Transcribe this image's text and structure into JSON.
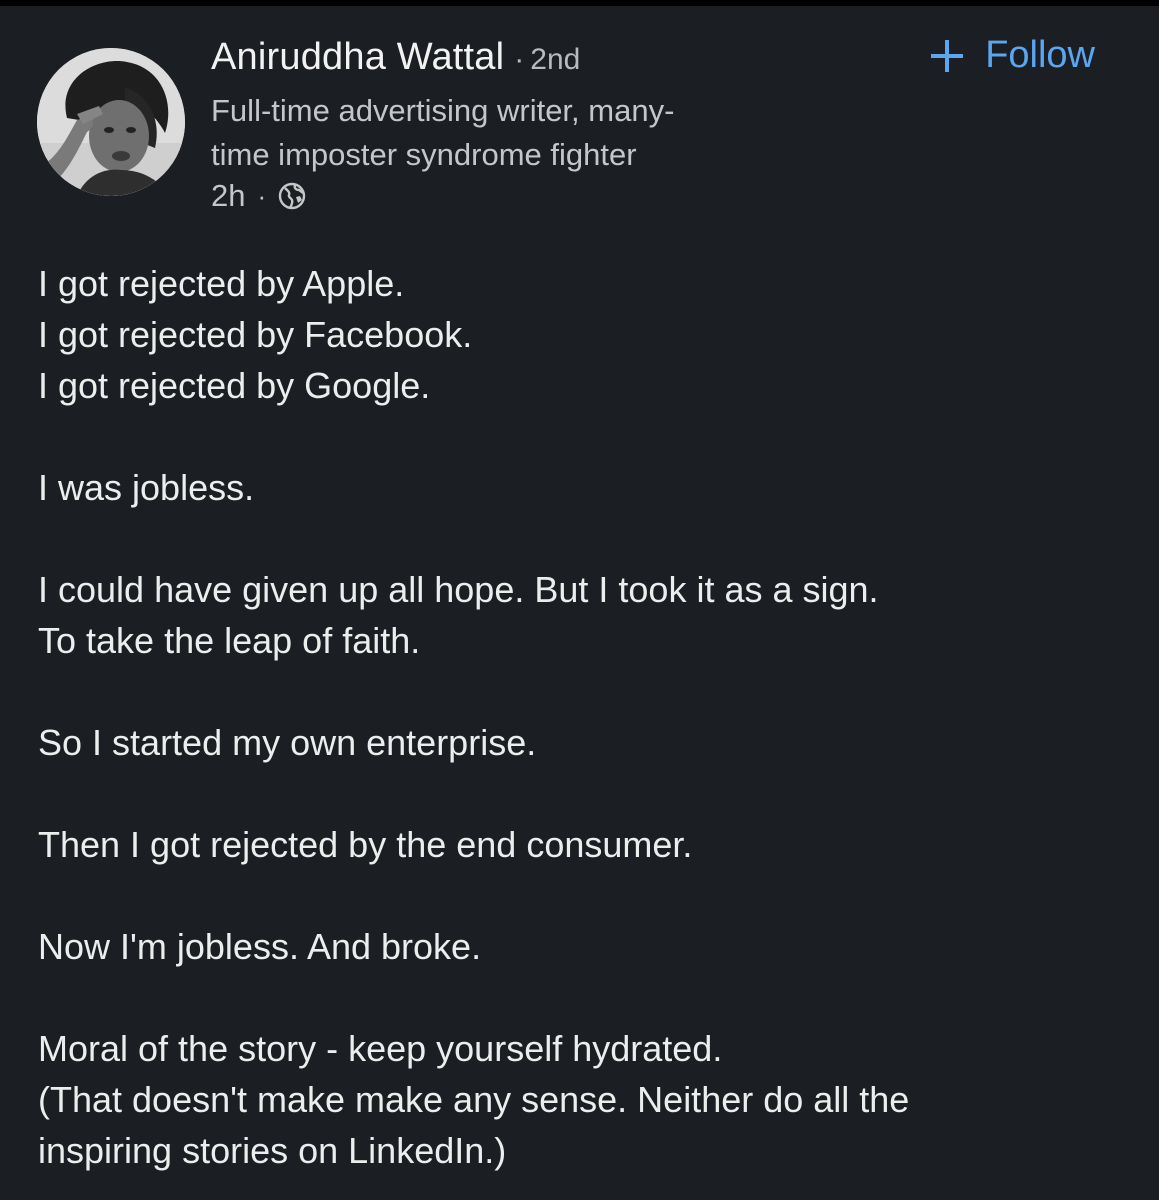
{
  "author": {
    "name": "Aniruddha Wattal",
    "degree_separator": "·",
    "degree": "2nd",
    "headline_lines": [
      "Full-time advertising writer, many-",
      "time imposter syndrome fighter"
    ],
    "time": "2h",
    "meta_separator": "·",
    "visibility_icon": "globe-icon"
  },
  "follow_button": {
    "icon": "plus-icon",
    "label": "Follow",
    "color": "#5aa6f0"
  },
  "post": {
    "paragraphs": [
      [
        "I got rejected by Apple.",
        "I got rejected by Facebook.",
        "I got rejected by Google."
      ],
      [
        "I was jobless."
      ],
      [
        "I could have given up all hope. But I took it as a sign.",
        "To take the leap of faith."
      ],
      [
        "So I started my own enterprise."
      ],
      [
        "Then I got rejected by the end consumer."
      ],
      [
        "Now I'm jobless. And broke."
      ],
      [
        "Moral of the story - keep yourself hydrated.",
        "(That doesn't make make any sense. Neither do all the",
        "inspiring stories on LinkedIn.)"
      ]
    ]
  },
  "theme": {
    "background": "#1b1f23",
    "text": "#eceded",
    "secondary_text": "#c4c6c8",
    "accent": "#5aa6f0"
  }
}
